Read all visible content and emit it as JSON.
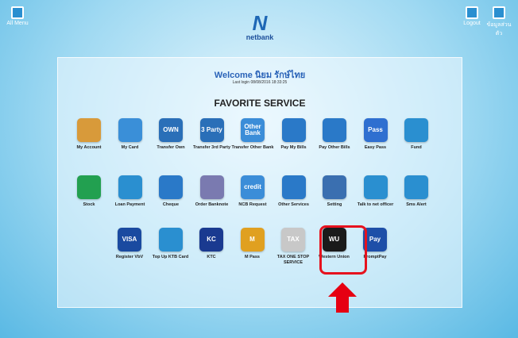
{
  "topbar": {
    "all_menu": "All Menu",
    "logout": "Logout",
    "user": "ข้อมูลส่วนตัว",
    "logo_text": "netbank"
  },
  "welcome": "Welcome นิยม รักษ์ไทย",
  "last_login": "Last login 08/08/2016 18:33:25",
  "section_title": "FAVORITE SERVICE",
  "row1": [
    {
      "label": "My Account",
      "icon": "wallet-icon",
      "color": "#d89a3a"
    },
    {
      "label": "My Card",
      "icon": "card-icon",
      "color": "#3a8fd8"
    },
    {
      "label": "Transfer Own",
      "icon": "transfer-own-icon",
      "color": "#2a6fb8",
      "text": "OWN"
    },
    {
      "label": "Transfer 3rd Party",
      "icon": "transfer-3rd-icon",
      "color": "#2a6fb8",
      "text": "3 Party"
    },
    {
      "label": "Transfer Other Bank",
      "icon": "transfer-other-bank-icon",
      "color": "#3b8dd8",
      "text": "Other Bank"
    },
    {
      "label": "Pay My Bills",
      "icon": "pay-bills-icon",
      "color": "#2a79c8"
    },
    {
      "label": "Pay Other Bills",
      "icon": "pay-other-bills-icon",
      "color": "#2a79c8"
    },
    {
      "label": "Easy Pass",
      "icon": "easy-pass-icon",
      "color": "#2f6fd0",
      "text": "Pass"
    },
    {
      "label": "Fund",
      "icon": "fund-icon",
      "color": "#2a8fd0"
    }
  ],
  "row2": [
    {
      "label": "Stock",
      "icon": "stock-icon",
      "color": "#22a050"
    },
    {
      "label": "Loan Payment",
      "icon": "loan-payment-icon",
      "color": "#2a8fd0"
    },
    {
      "label": "Cheque",
      "icon": "cheque-icon",
      "color": "#2a79c8"
    },
    {
      "label": "Order Banknote",
      "icon": "banknote-icon",
      "color": "#7a7ab0"
    },
    {
      "label": "NCB Request",
      "icon": "ncb-icon",
      "color": "#3b8dd8",
      "text": "credit"
    },
    {
      "label": "Other Services",
      "icon": "other-services-icon",
      "color": "#2a79c8"
    },
    {
      "label": "Setting",
      "icon": "setting-icon",
      "color": "#3a6fb0"
    },
    {
      "label": "Talk to net officer",
      "icon": "talk-officer-icon",
      "color": "#2a8fd0"
    },
    {
      "label": "Sms Alert",
      "icon": "sms-alert-icon",
      "color": "#2a8fd0"
    }
  ],
  "row3": [
    {
      "label": "Register VbV",
      "icon": "visa-icon",
      "color": "#1a4aa0",
      "text": "VISA"
    },
    {
      "label": "Top Up KTB Card",
      "icon": "topup-icon",
      "color": "#2a8fd0"
    },
    {
      "label": "KTC",
      "icon": "ktc-icon",
      "color": "#1a3a90",
      "text": "KC"
    },
    {
      "label": "M Pass",
      "icon": "mpass-icon",
      "color": "#e0a020",
      "text": "M"
    },
    {
      "label": "TAX ONE STOP SERVICE",
      "icon": "tax-icon",
      "color": "#c8c8c8",
      "text": "TAX"
    },
    {
      "label": "Western Union",
      "icon": "western-union-icon",
      "color": "#1a1a1a",
      "text": "WU"
    },
    {
      "label": "PromptPay",
      "icon": "promptpay-icon",
      "color": "#1e4fa8",
      "text": "Pay"
    }
  ]
}
